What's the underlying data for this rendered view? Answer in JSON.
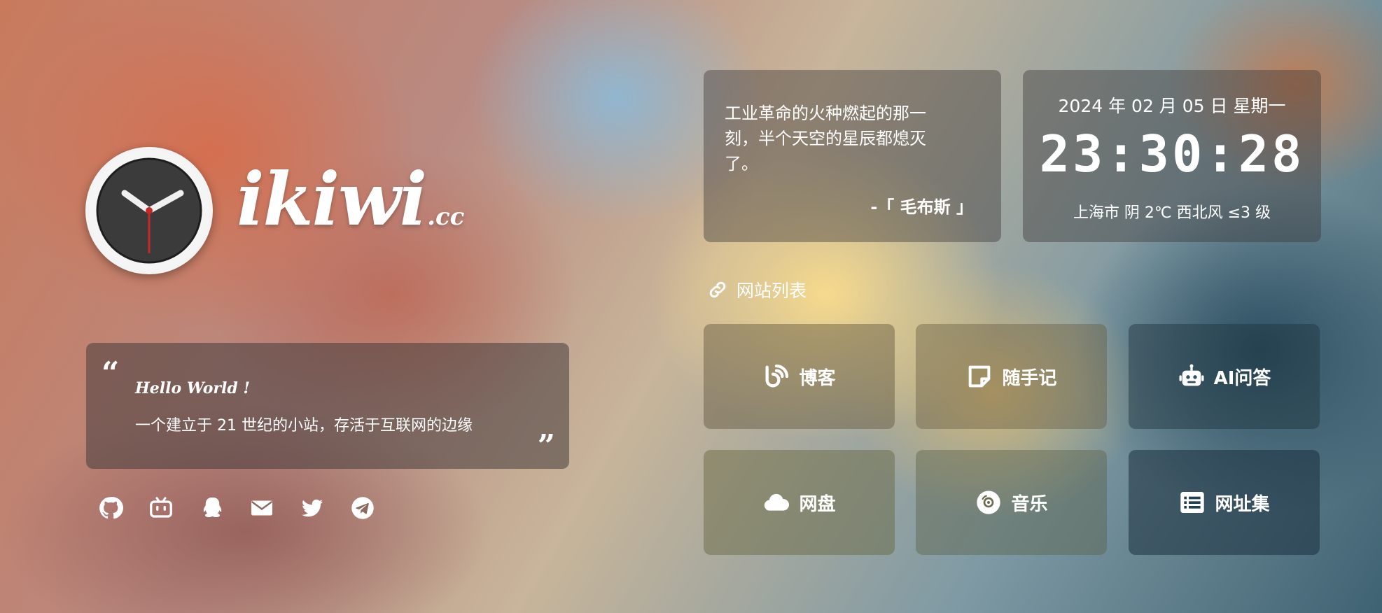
{
  "brand": {
    "name": "ikiwi",
    "tld": ".cc"
  },
  "greeting": {
    "hello": "Hello World !",
    "description": "一个建立于 21 世纪的小站，存活于互联网的边缘"
  },
  "socials": [
    {
      "icon": "github-icon"
    },
    {
      "icon": "bilibili-icon"
    },
    {
      "icon": "qq-icon"
    },
    {
      "icon": "email-icon"
    },
    {
      "icon": "twitter-icon"
    },
    {
      "icon": "telegram-icon"
    }
  ],
  "quote": {
    "text": "工业革命的火种燃起的那一刻，半个天空的星辰都熄灭了。",
    "author": "-「 毛布斯 」"
  },
  "time": {
    "date": "2024 年 02 月 05 日 星期一",
    "clock": "23:30:28",
    "weather": "上海市 阴 2℃ 西北风 ≤3 级"
  },
  "sites": {
    "title": "网站列表",
    "items": [
      {
        "label": "博客",
        "icon": "blog-icon"
      },
      {
        "label": "随手记",
        "icon": "note-icon"
      },
      {
        "label": "AI问答",
        "icon": "robot-icon"
      },
      {
        "label": "网盘",
        "icon": "cloud-icon"
      },
      {
        "label": "音乐",
        "icon": "music-disc-icon"
      },
      {
        "label": "网址集",
        "icon": "list-icon"
      }
    ]
  }
}
